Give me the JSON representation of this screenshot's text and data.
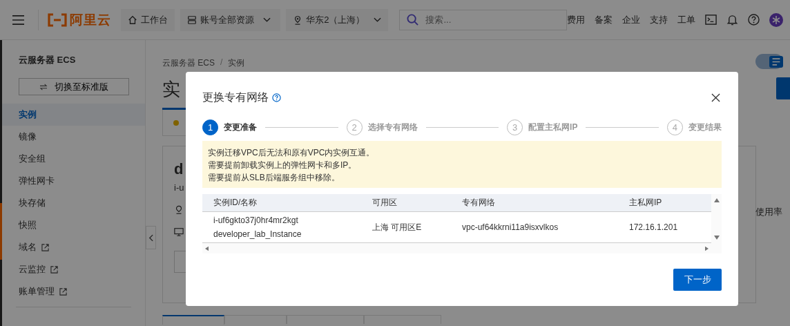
{
  "topbar": {
    "logo_text": "阿里云",
    "nav_buttons": [
      {
        "kind": "home",
        "label": "工作台",
        "dropdown": false
      },
      {
        "kind": "resources",
        "label": "账号全部资源",
        "dropdown": true
      },
      {
        "kind": "region",
        "label": "华东2（上海）",
        "dropdown": true
      }
    ],
    "search": {
      "placeholder": "搜索..."
    },
    "links": [
      "费用",
      "备案",
      "企业",
      "支持",
      "工单"
    ]
  },
  "sidebar": {
    "title": "云服务器 ECS",
    "switch_button": "切换至标准版",
    "items": [
      {
        "label": "实例",
        "selected": true,
        "external": false
      },
      {
        "label": "镜像",
        "selected": false,
        "external": false
      },
      {
        "label": "安全组",
        "selected": false,
        "external": false
      },
      {
        "label": "弹性网卡",
        "selected": false,
        "external": false
      },
      {
        "label": "块存储",
        "selected": false,
        "external": false
      },
      {
        "label": "快照",
        "selected": false,
        "external": false
      },
      {
        "label": "域名",
        "selected": false,
        "external": true
      },
      {
        "label": "云监控",
        "selected": false,
        "external": true
      },
      {
        "label": "账单管理",
        "selected": false,
        "external": true
      }
    ]
  },
  "page": {
    "breadcrumb": [
      "云服务器 ECS",
      "实例"
    ],
    "breadcrumb_separator": "/",
    "title": "实",
    "card": {
      "name": "d",
      "id": "i-u"
    },
    "metric_label": "使用率",
    "view_toggle": {
      "on": true
    },
    "bottom_tabs": [
      {
        "selected": true
      },
      {
        "selected": false
      },
      {
        "selected": false
      },
      {
        "selected": false
      }
    ]
  },
  "dialog": {
    "title": "更换专有网络",
    "steps": [
      {
        "number": "1",
        "label": "变更准备",
        "selected": true
      },
      {
        "number": "2",
        "label": "选择专有网络",
        "selected": false
      },
      {
        "number": "3",
        "label": "配置主私网IP",
        "selected": false
      },
      {
        "number": "4",
        "label": "变更结果",
        "selected": false
      }
    ],
    "notices": [
      "实例迁移VPC后无法和原有VPC内实例互通。",
      "需要提前卸载实例上的弹性网卡和多IP。",
      "需要提前从SLB后端服务组中移除。"
    ],
    "table": {
      "columns": [
        "实例ID/名称",
        "可用区",
        "专有网络",
        "主私网IP"
      ],
      "rows": [
        {
          "id": "i-uf6gkto37j0hr4mr2kgt",
          "name": "developer_lab_Instance",
          "zone": "上海 可用区E",
          "vpc": "vpc-uf64kkrni11a9isxvlkos",
          "ip": "172.16.1.201"
        }
      ]
    },
    "next_button": "下一步"
  }
}
